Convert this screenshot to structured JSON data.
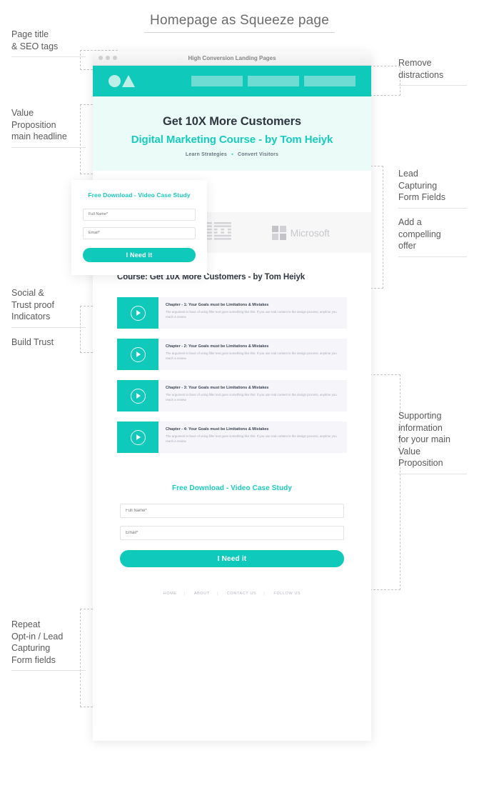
{
  "page_heading": "Homepage as Squeeze page",
  "annotations": {
    "left": [
      {
        "id": "page-title-seo",
        "text": "Page title\n& SEO tags"
      },
      {
        "id": "value-proposition",
        "text": "Value\nProposition\nmain headline"
      },
      {
        "id": "social-trust-proof",
        "text": "Social &\nTrust proof\nIndicators"
      },
      {
        "id": "build-trust",
        "text": "Build Trust"
      },
      {
        "id": "repeat-optin",
        "text": "Repeat\nOpt-in / Lead\nCapturing\nForm fields"
      }
    ],
    "right": [
      {
        "id": "remove-distractions",
        "text": "Remove\ndistractions"
      },
      {
        "id": "lead-capturing-form-fields",
        "text": "Lead\nCapturing\nForm Fields"
      },
      {
        "id": "add-compelling-offer",
        "text": "Add a\ncompelling\noffer"
      },
      {
        "id": "supporting-information",
        "text": "Supporting\ninformation\nfor your main\nValue\nProposition"
      }
    ]
  },
  "browser": {
    "title": "High Conversion Landing Pages"
  },
  "navbar": {
    "logo_shapes": [
      "circle",
      "triangle"
    ],
    "nav_placeholders": 3
  },
  "hero": {
    "headline": "Get 10X More Customers",
    "subheadline": "Digital Marketing Course - by Tom Heiyk",
    "tagline_left": "Learn Strategies",
    "tagline_bullet": "▪",
    "tagline_right": "Convert Visitors"
  },
  "form_top": {
    "title": "Free Download - Video Case Study",
    "name_placeholder": "Full Name*",
    "email_placeholder": "Email*",
    "cta_label": "I Need it"
  },
  "logos": {
    "items": [
      {
        "name": "apple-logo",
        "label": ""
      },
      {
        "name": "ibm-logo",
        "label": "IBM"
      },
      {
        "name": "microsoft-logo",
        "label": "Microsoft"
      }
    ]
  },
  "course": {
    "title": "Course: Get 10X More Customers - by Tom Heiyk",
    "chapters": [
      {
        "title": "Chapter - 1: Your Goals must be Limitations & Mistakes",
        "description": "The argument in favor of using filler text goes something like this: If you use real content in the design process, anytime you reach a review."
      },
      {
        "title": "Chapter - 2: Your Goals must be Limitations & Mistakes",
        "description": "The argument in favor of using filler text goes something like this: If you use real content in the design process, anytime you reach a review."
      },
      {
        "title": "Chapter - 3: Your Goals must be Limitations & Mistakes",
        "description": "The argument in favor of using filler text goes something like this: If you use real content in the design process, anytime you reach a review."
      },
      {
        "title": "Chapter - 4: Your Goals must be Limitations & Mistakes",
        "description": "The argument in favor of using filler text goes something like this: If you use real content in the design process, anytime you reach a review."
      }
    ]
  },
  "form_bottom": {
    "title": "Free Download - Video Case Study",
    "name_placeholder": "Full Name*",
    "email_placeholder": "Email*",
    "cta_label": "I Need it"
  },
  "footer": {
    "links": [
      "HOME",
      "ABOUT",
      "CONTACT US",
      "FOLLOW US"
    ],
    "separator": "|"
  },
  "colors": {
    "accent_teal": "#0FCABB",
    "hero_tint": "#EAFBF8",
    "chapter_bg": "#F5F5FA",
    "logo_strip_bg": "#F7F7F8",
    "heading_dark": "#2F3640",
    "annotation_text": "#5A5A5A",
    "dashed_border": "#C6C6C6"
  }
}
